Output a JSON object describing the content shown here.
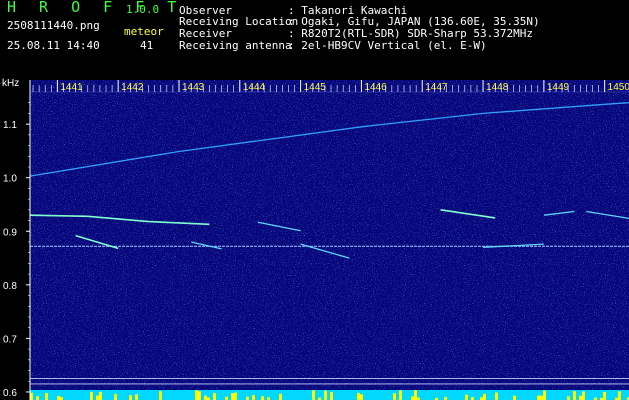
{
  "header": {
    "logo": "H R O F F T",
    "version": "1.0.0",
    "filename": "2508111440.png",
    "datetime": "25.08.11 14:40",
    "meteor_label": "meteor",
    "meteor_count": "41",
    "fields": [
      {
        "key": "Observer",
        "value": ": Takanori Kawachi"
      },
      {
        "key": "Receiving Location",
        "value": ": Ogaki, Gifu, JAPAN (136.60E, 35.35N)"
      },
      {
        "key": "Receiver",
        "value": ": R820T2(RTL-SDR) SDR-Sharp 53.372MHz"
      },
      {
        "key": "Receiving antenna",
        "value": ": 2el-HB9CV Vertical (el. E-W)"
      }
    ]
  },
  "colors": {
    "background": "#06067a",
    "text_green": "#3cff3c",
    "text_white": "#ffffff",
    "text_yellow": "#ffff33",
    "trace_bright": "#7fffd0",
    "trace_main": "#35a8ff",
    "noise_cyan": "#00d8ff",
    "noise_yellow": "#ffff00"
  },
  "chart_data": {
    "type": "spectrogram",
    "xlabel": "",
    "ylabel": "kHz",
    "x_ticks": [
      "1441",
      "1442",
      "1443",
      "1444",
      "1445",
      "1446",
      "1447",
      "1448",
      "1449",
      "1450"
    ],
    "y_ticks": [
      "1.1",
      "1.0",
      "0.9",
      "0.8",
      "0.7",
      "0.6"
    ],
    "xlim": [
      1440.55,
      1450.4
    ],
    "ylim": [
      0.585,
      1.16
    ],
    "reference_lines_khz": [
      0.625,
      0.615
    ],
    "traces": [
      {
        "points": [
          [
            1440.55,
            1.003
          ],
          [
            1443.0,
            1.049
          ],
          [
            1446.0,
            1.095
          ],
          [
            1448.0,
            1.12
          ],
          [
            1450.0,
            1.137
          ],
          [
            1450.4,
            1.14
          ]
        ],
        "style": "faint"
      },
      {
        "points": [
          [
            1440.55,
            0.872
          ],
          [
            1450.4,
            0.872
          ]
        ],
        "style": "carrier"
      },
      {
        "points": [
          [
            1440.55,
            0.93
          ],
          [
            1441.5,
            0.928
          ],
          [
            1442.5,
            0.918
          ],
          [
            1443.5,
            0.913
          ]
        ],
        "style": "bright"
      },
      {
        "points": [
          [
            1441.3,
            0.892
          ],
          [
            1442.0,
            0.868
          ]
        ],
        "style": "bright"
      },
      {
        "points": [
          [
            1443.2,
            0.88
          ],
          [
            1443.7,
            0.867
          ]
        ],
        "style": "medium"
      },
      {
        "points": [
          [
            1444.3,
            0.917
          ],
          [
            1445.0,
            0.901
          ]
        ],
        "style": "medium"
      },
      {
        "points": [
          [
            1445.0,
            0.876
          ],
          [
            1445.8,
            0.85
          ]
        ],
        "style": "medium"
      },
      {
        "points": [
          [
            1447.3,
            0.94
          ],
          [
            1448.2,
            0.925
          ]
        ],
        "style": "bright"
      },
      {
        "points": [
          [
            1449.0,
            0.93
          ],
          [
            1449.5,
            0.937
          ]
        ],
        "style": "medium"
      },
      {
        "points": [
          [
            1449.7,
            0.937
          ],
          [
            1450.4,
            0.924
          ]
        ],
        "style": "medium"
      },
      {
        "points": [
          [
            1448.0,
            0.87
          ],
          [
            1449.0,
            0.876
          ]
        ],
        "style": "medium"
      }
    ]
  }
}
